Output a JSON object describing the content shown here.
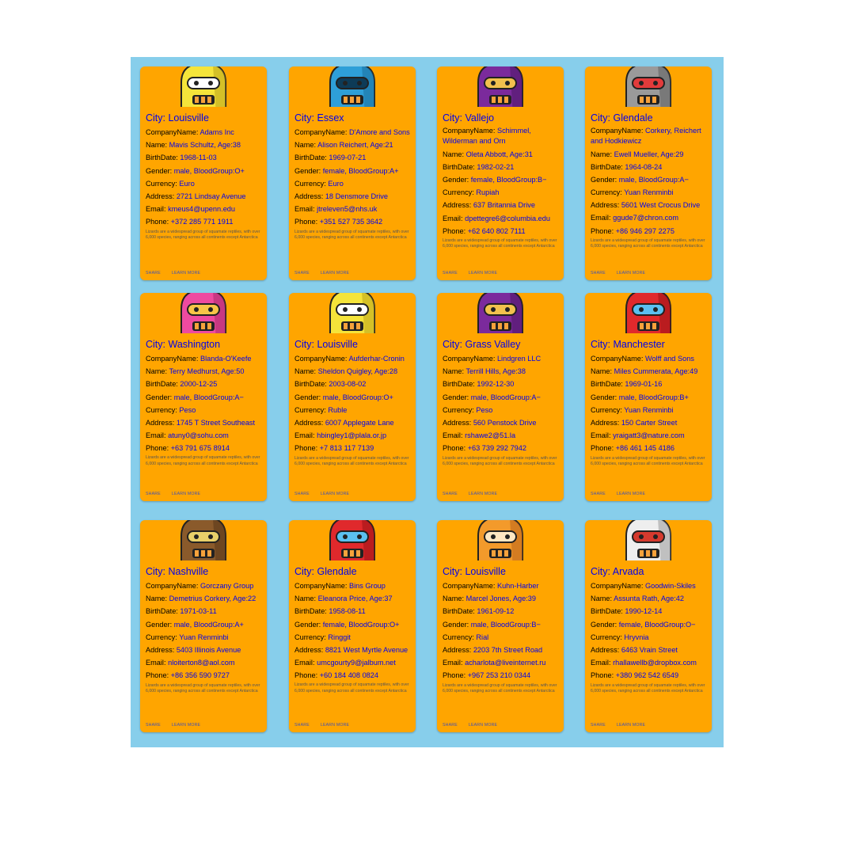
{
  "colors": {
    "panel": "#87ceeb",
    "card": "#ffa500",
    "value_text": "#0000ee",
    "action_text": "#3f51b5"
  },
  "labels": {
    "city": "City: ",
    "company": "CompanyName: ",
    "name": "Name: ",
    "birth": "BirthDate: ",
    "gender": "Gender: ",
    "currency": "Currency: ",
    "address": "Address: ",
    "email": "Email: ",
    "phone": "Phone: "
  },
  "description": "Lizards are a widespread group of squamate reptiles, with over 6,000 species, ranging across all continents except Antarctica",
  "actions": {
    "share": "SHARE",
    "learn_more": "LEARN MORE"
  },
  "cards": [
    {
      "avatar": "yellow-robot-avatar",
      "city": "Louisville",
      "company": "Adams Inc",
      "name_age": "Mavis Schultz, Age:38",
      "birth": "1968-11-03",
      "gender_blood": "male, BloodGroup:O+",
      "currency": "Euro",
      "address": "2721 Lindsay Avenue",
      "email": "kmeus4@upenn.edu",
      "phone": "+372 285 771 1911"
    },
    {
      "avatar": "blue-robot-avatar",
      "city": "Essex",
      "company": "D'Amore and Sons",
      "name_age": "Alison Reichert, Age:21",
      "birth": "1969-07-21",
      "gender_blood": "female, BloodGroup:A+",
      "currency": "Euro",
      "address": "18 Densmore Drive",
      "email": "jtreleven5@nhs.uk",
      "phone": "+351 527 735 3642"
    },
    {
      "avatar": "purple-robot-avatar",
      "city": "Vallejo",
      "company": "Schimmel, Wilderman and Orn",
      "name_age": "Oleta Abbott, Age:31",
      "birth": "1982-02-21",
      "gender_blood": "female, BloodGroup:B−",
      "currency": "Rupiah",
      "address": "637 Britannia Drive",
      "email": "dpettegre6@columbia.edu",
      "phone": "+62 640 802 7111"
    },
    {
      "avatar": "gray-robot-avatar",
      "city": "Glendale",
      "company": "Corkery, Reichert and Hodkiewicz",
      "name_age": "Ewell Mueller, Age:29",
      "birth": "1964-08-24",
      "gender_blood": "male, BloodGroup:A−",
      "currency": "Yuan Renminbi",
      "address": "5601 West Crocus Drive",
      "email": "ggude7@chron.com",
      "phone": "+86 946 297 2275"
    },
    {
      "avatar": "pink-robot-avatar",
      "city": "Washington",
      "company": "Blanda-O'Keefe",
      "name_age": "Terry Medhurst, Age:50",
      "birth": "2000-12-25",
      "gender_blood": "male, BloodGroup:A−",
      "currency": "Peso",
      "address": "1745 T Street Southeast",
      "email": "atuny0@sohu.com",
      "phone": "+63 791 675 8914"
    },
    {
      "avatar": "yellow-robot-avatar",
      "city": "Louisville",
      "company": "Aufderhar-Cronin",
      "name_age": "Sheldon Quigley, Age:28",
      "birth": "2003-08-02",
      "gender_blood": "male, BloodGroup:O+",
      "currency": "Ruble",
      "address": "6007 Applegate Lane",
      "email": "hbingley1@plala.or.jp",
      "phone": "+7 813 117 7139"
    },
    {
      "avatar": "purple-robot-avatar",
      "city": "Grass Valley",
      "company": "Lindgren LLC",
      "name_age": "Terrill Hills, Age:38",
      "birth": "1992-12-30",
      "gender_blood": "male, BloodGroup:A−",
      "currency": "Peso",
      "address": "560 Penstock Drive",
      "email": "rshawe2@51.la",
      "phone": "+63 739 292 7942"
    },
    {
      "avatar": "red-robot-avatar",
      "city": "Manchester",
      "company": "Wolff and Sons",
      "name_age": "Miles Cummerata, Age:49",
      "birth": "1969-01-16",
      "gender_blood": "male, BloodGroup:B+",
      "currency": "Yuan Renminbi",
      "address": "150 Carter Street",
      "email": "yraigatt3@nature.com",
      "phone": "+86 461 145 4186"
    },
    {
      "avatar": "brown-robot-avatar",
      "city": "Nashville",
      "company": "Gorczany Group",
      "name_age": "Demetrius Corkery, Age:22",
      "birth": "1971-03-11",
      "gender_blood": "male, BloodGroup:A+",
      "currency": "Yuan Renminbi",
      "address": "5403 Illinois Avenue",
      "email": "nloiterton8@aol.com",
      "phone": "+86 356 590 9727"
    },
    {
      "avatar": "red-robot-avatar",
      "city": "Glendale",
      "company": "Bins Group",
      "name_age": "Eleanora Price, Age:37",
      "birth": "1958-08-11",
      "gender_blood": "female, BloodGroup:O+",
      "currency": "Ringgit",
      "address": "8821 West Myrtle Avenue",
      "email": "umcgourty9@jalbum.net",
      "phone": "+60 184 408 0824"
    },
    {
      "avatar": "orange-robot-avatar",
      "city": "Louisville",
      "company": "Kuhn-Harber",
      "name_age": "Marcel Jones, Age:39",
      "birth": "1961-09-12",
      "gender_blood": "male, BloodGroup:B−",
      "currency": "Rial",
      "address": "2203 7th Street Road",
      "email": "acharlota@liveinternet.ru",
      "phone": "+967 253 210 0344"
    },
    {
      "avatar": "white-robot-avatar",
      "city": "Arvada",
      "company": "Goodwin-Skiles",
      "name_age": "Assunta Rath, Age:42",
      "birth": "1990-12-14",
      "gender_blood": "female, BloodGroup:O−",
      "currency": "Hryvnia",
      "address": "6463 Vrain Street",
      "email": "rhallawellb@dropbox.com",
      "phone": "+380 962 542 6549"
    }
  ]
}
